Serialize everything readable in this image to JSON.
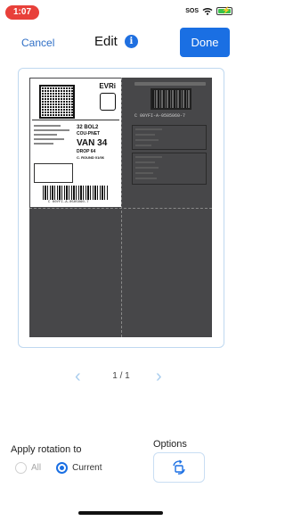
{
  "status_bar": {
    "time": "1:07",
    "carrier": "SOS"
  },
  "nav": {
    "cancel_label": "Cancel",
    "title": "Edit",
    "info_icon": "info-icon",
    "done_label": "Done"
  },
  "preview": {
    "label_brand": "EVRi",
    "route_line1": "32 BOL2",
    "route_line2": "COU-PNET",
    "route_big": "VAN 34",
    "route_drop": "DROP 64",
    "route_round": "C. ROUND 01/06",
    "barcode_text": "C 00YFI-A-0505060-7",
    "right_code": "C 00YFI-A-0505060-7"
  },
  "pager": {
    "indicator": "1 / 1",
    "prev_icon": "chevron-left-icon",
    "next_icon": "chevron-right-icon"
  },
  "rotation": {
    "label": "Apply rotation to",
    "options": [
      {
        "label": "All",
        "selected": false
      },
      {
        "label": "Current",
        "selected": true
      }
    ]
  },
  "options": {
    "label": "Options",
    "icon": "rotate-icon"
  },
  "colors": {
    "accent": "#1a6fe3",
    "status_red": "#e8403a",
    "frame_border": "#bfd8f0",
    "page_bg": "#474749"
  }
}
